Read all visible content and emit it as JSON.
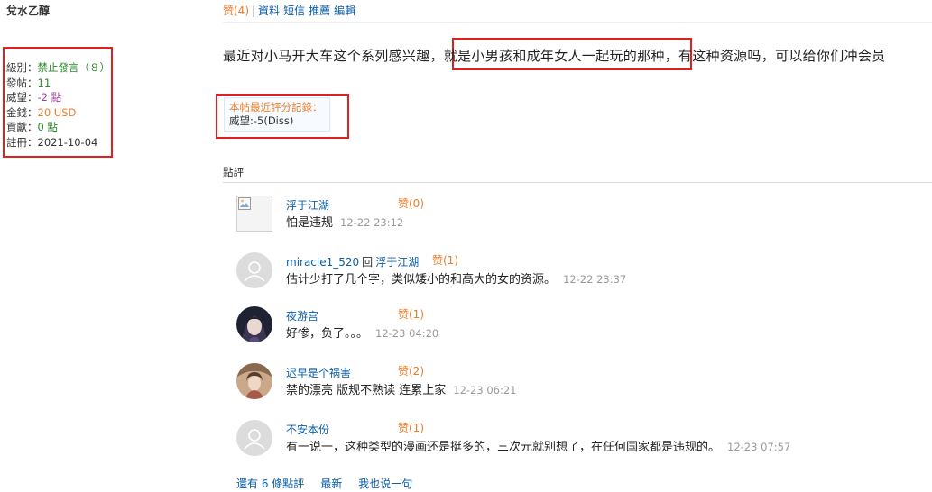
{
  "author": {
    "name": "兌水乙醇",
    "info": [
      {
        "label": "級別：",
        "value": "禁止發言（８）",
        "color": "#2a8a2a"
      },
      {
        "label": "發帖：",
        "value": "11",
        "color": "#2a8a2a"
      },
      {
        "label": "威望：",
        "value": "-2 點",
        "color": "#a040a0"
      },
      {
        "label": "金錢：",
        "value": "20 USD",
        "color": "#e87d2a"
      },
      {
        "label": "貢獻：",
        "value": "0 點",
        "color": "#2a8a2a"
      },
      {
        "label": "註冊：",
        "value": "2021-10-04",
        "color": "#333333"
      }
    ]
  },
  "toolbar": {
    "praise": "赞(4)",
    "separator": "|",
    "links": [
      "資料",
      "短信",
      "推薦",
      "編輯"
    ]
  },
  "post": {
    "text_before": "最近对小马开大车这个系列感兴趣，",
    "text_highlight": "就是小男孩和成年女人一起玩的那种",
    "text_after": "，有这种资源吗，可以给你们冲会员"
  },
  "rating": {
    "title": "本帖最近評分記錄：",
    "entry": "威望:-5(Diss)"
  },
  "comments_heading": "點評",
  "comments": [
    {
      "user": "浮于江湖",
      "reply_word": "",
      "reply_to": "",
      "praise": "赞(0)",
      "text": "怕是违规",
      "time": "12-22 23:12",
      "avatar": "broken-image"
    },
    {
      "user": "miracle1_520",
      "reply_word": "回",
      "reply_to": "浮于江湖",
      "praise": "赞(1)",
      "text": "估计少打了几个字，类似矮小的和高大的女的资源。",
      "time": "12-22 23:37",
      "avatar": "default-user"
    },
    {
      "user": "夜游宫",
      "reply_word": "",
      "reply_to": "",
      "praise": "赞(1)",
      "text": "好惨，负了。。。",
      "time": "12-23 04:20",
      "avatar": "portrait-dark"
    },
    {
      "user": "迟早是个祸害",
      "reply_word": "",
      "reply_to": "",
      "praise": "赞(2)",
      "text": "禁的漂亮 版规不熟读 连累上家",
      "time": "12-23 06:21",
      "avatar": "portrait-warm"
    },
    {
      "user": "不安本份",
      "reply_word": "",
      "reply_to": "",
      "praise": "赞(1)",
      "text": "有一说一，这种类型的漫画还是挺多的，三次元就别想了，在任何国家都是违规的。",
      "time": "12-23 07:57",
      "avatar": "default-user"
    }
  ],
  "footer": {
    "more": "還有 6 條點評",
    "latest": "最新",
    "reply": "我也说一句"
  },
  "colors": {
    "link": "#0b5ea8",
    "praise": "#e87d2a",
    "highlight_border": "#e02020"
  }
}
